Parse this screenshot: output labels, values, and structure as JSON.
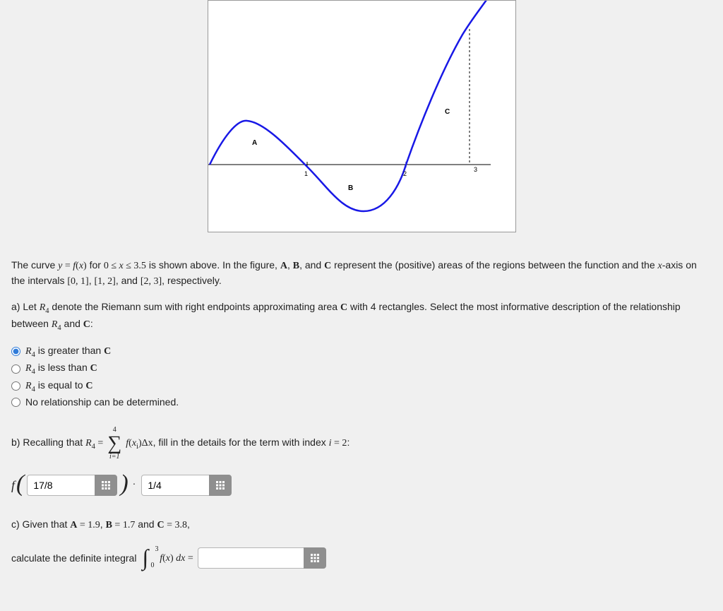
{
  "graph": {
    "labelA": "A",
    "labelB": "B",
    "labelC": "C",
    "tick1": "1",
    "tick2": "2",
    "tick3": "3"
  },
  "intro": {
    "t1": "The curve ",
    "eq_y": "y",
    "eq_eq": " = ",
    "eq_fx": "f",
    "eq_open": "(",
    "eq_x": "x",
    "eq_close": ")",
    "t2": " for ",
    "rng_lo": "0 ≤ ",
    "rng_x": "x",
    "rng_hi": " ≤ 3.5",
    "t3": " is shown above. In the figure, ",
    "labA": "A",
    "comma1": ", ",
    "labB": "B",
    "comma2": ", and ",
    "labC": "C",
    "t4": " represent the (positive) areas of the regions between the function and the ",
    "xax": "x",
    "t5": "-axis on the intervals ",
    "int01": "[0, 1]",
    "c1": ", ",
    "int12": "[1, 2]",
    "c2": ", and ",
    "int23": "[2, 3]",
    "t6": ", respectively."
  },
  "partA": {
    "lead1": "a) Let ",
    "R4": "R",
    "R4sub": "4",
    "lead2": " denote the Riemann sum with right endpoints approximating area ",
    "C": "C",
    "lead3": " with 4 rectangles. Select the most informative description of the relationship between ",
    "and": " and ",
    "colon": ":",
    "opt1a": " is greater than ",
    "opt2a": " is less than ",
    "opt3a": " is equal to ",
    "opt4": "No relationship can be determined."
  },
  "partB": {
    "lead1": "b) Recalling that ",
    "R4": "R",
    "R4sub": "4",
    "eq": " = ",
    "sum_top": "4",
    "sum_bot": "i=1",
    "sum_body_f": "f",
    "sum_body_open": "(",
    "sum_body_xi": "x",
    "sum_body_i": "i",
    "sum_body_close": ")",
    "sum_body_dx": "Δx",
    "lead2": ", fill in the details for the term with index ",
    "idx_i": "i",
    "idx_eq": " = 2",
    "colon": ":",
    "f": "f",
    "input1": "17/8",
    "dot": "·",
    "input2": "1/4"
  },
  "partC": {
    "lead1": "c) Given that ",
    "A": "A",
    "Aval": " = 1.9",
    "c1": ", ",
    "B": "B",
    "Bval": " = 1.7",
    "and": " and ",
    "C": "C",
    "Cval": " = 3.8",
    "comma": ",",
    "calc": "calculate the definite integral ",
    "int_lo": "0",
    "int_hi": "3",
    "f": "f",
    "open": "(",
    "x": "x",
    "close": ")",
    "dx": " dx",
    "eq": " = ",
    "input": ""
  },
  "chart_data": {
    "type": "line",
    "title": "",
    "xlabel": "",
    "ylabel": "",
    "xlim": [
      0,
      3.5
    ],
    "ylim": [
      -3.2,
      11
    ],
    "series": [
      {
        "name": "f(x)",
        "x": [
          0,
          0.25,
          0.5,
          0.75,
          1.0,
          1.25,
          1.5,
          1.75,
          2.0,
          2.25,
          2.5,
          2.75,
          3.0,
          3.25,
          3.5
        ],
        "values": [
          0,
          1.3,
          1.9,
          1.5,
          0.0,
          -1.8,
          -2.8,
          -2.2,
          0.0,
          2.7,
          5.3,
          7.4,
          8.8,
          9.7,
          10.4
        ]
      }
    ],
    "annotations": [
      {
        "text": "A",
        "x": 0.55,
        "y": 1.0
      },
      {
        "text": "B",
        "x": 1.5,
        "y": -1.3
      },
      {
        "text": "C",
        "x": 2.55,
        "y": 5.4
      }
    ],
    "region_areas": {
      "A": 1.9,
      "B": 1.7,
      "C": 3.8
    }
  }
}
